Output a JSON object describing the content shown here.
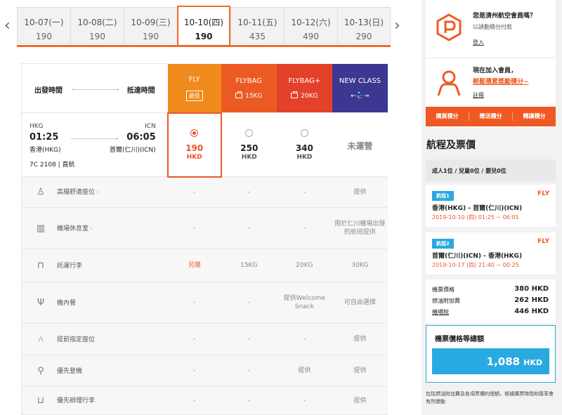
{
  "dates": [
    {
      "label": "10-07(一)",
      "price": "190",
      "active": false
    },
    {
      "label": "10-08(二)",
      "price": "190",
      "active": false
    },
    {
      "label": "10-09(三)",
      "price": "190",
      "active": false
    },
    {
      "label": "10-10(四)",
      "price": "190",
      "active": true
    },
    {
      "label": "10-11(五)",
      "price": "435",
      "active": false
    },
    {
      "label": "10-12(六)",
      "price": "490",
      "active": false
    },
    {
      "label": "10-13(日)",
      "price": "290",
      "active": false
    }
  ],
  "nav": {
    "prev_icon": "chevron-left-icon",
    "next_icon": "chevron-right-icon"
  },
  "table_header": {
    "departure_label": "出發時間",
    "arrival_label": "抵達時間",
    "fares": [
      {
        "name": "FLY",
        "sub": "最低",
        "color": "#f08a1c"
      },
      {
        "name": "FLYBAG",
        "sub": "15KG",
        "color": "#ec5a24"
      },
      {
        "name": "FLYBAG+",
        "sub": "20KG",
        "color": "#e4412a"
      },
      {
        "name": "NEW CLASS",
        "sub": "←💺→",
        "color": "#3c3891"
      }
    ]
  },
  "flight": {
    "dep_code": "HKG",
    "arr_code": "ICN",
    "dep_time": "01:25",
    "arr_time": "06:05",
    "dep_city": "香港(HKG)",
    "arr_city": "首爾(仁川)(ICN)",
    "flight_no": "7C 2108 | 直航"
  },
  "fares": [
    {
      "price": "190",
      "currency": "HKD",
      "selected": true
    },
    {
      "price": "250",
      "currency": "HKD",
      "selected": false
    },
    {
      "price": "340",
      "currency": "HKD",
      "selected": false
    },
    {
      "not_operated": "未運營"
    }
  ],
  "services": [
    {
      "icon": "seat-icon",
      "label": "高檔舒適座位",
      "values": [
        "-",
        "-",
        "-",
        "提供"
      ]
    },
    {
      "icon": "lounge-icon",
      "label": "機場休息室",
      "values": [
        "-",
        "-",
        "-",
        "限於仁川機場出發的航班提供"
      ]
    },
    {
      "icon": "baggage-icon",
      "label": "託運行李",
      "values": [
        "另購",
        "15KG",
        "20KG",
        "30KG"
      ]
    },
    {
      "icon": "meal-icon",
      "label": "機內餐",
      "values": [
        "-",
        "-",
        "提供Welcome Snack",
        "可自由選擇"
      ]
    },
    {
      "icon": "seat-select-icon",
      "label": "提前指定座位",
      "values": [
        "-",
        "-",
        "-",
        "提供"
      ]
    },
    {
      "icon": "boarding-icon",
      "label": "優先登機",
      "values": [
        "-",
        "-",
        "提供",
        "提供"
      ]
    },
    {
      "icon": "priority-baggage-icon",
      "label": "優先辦理行李",
      "values": [
        "-",
        "-",
        "-",
        "提供"
      ]
    }
  ],
  "member": {
    "q_title": "您是濟州航空會員嗎？",
    "q_sub": "以誘動積分付款",
    "login": "登入",
    "join_title": "現在加入會員，",
    "join_red": "輕鬆積累獎勵積分~",
    "register": "註冊",
    "points_buttons": [
      "購買積分",
      "贈送積分",
      "轉讓積分"
    ]
  },
  "itinerary": {
    "title": "航程及票價",
    "pax": "成人1位 / 兒童0位 / 嬰兒0位",
    "segments": [
      {
        "badge": "航程1",
        "fare": "FLY",
        "route": "香港(HKG) - 首爾(仁川)(ICN)",
        "time": "2019-10-10 (四) 01:25 ~ 06:05"
      },
      {
        "badge": "航程2",
        "fare": "FLY",
        "route": "首爾(仁川)(ICN) - 香港(HKG)",
        "time": "2019-10-17 (四) 21:40 ~ 00:25"
      }
    ],
    "costs": [
      {
        "label": "機票價格",
        "value": "380 HKD"
      },
      {
        "label": "燃油附加費",
        "value": "262 HKD"
      },
      {
        "label": "機場稅",
        "value": "446 HKD"
      }
    ],
    "total_label": "機票價格等總額",
    "total_amount": "1,088",
    "total_currency": "HKD",
    "footnote": "包括燃油附加費及各項票價的總額，根據購票時間和匯率會有所變動"
  }
}
